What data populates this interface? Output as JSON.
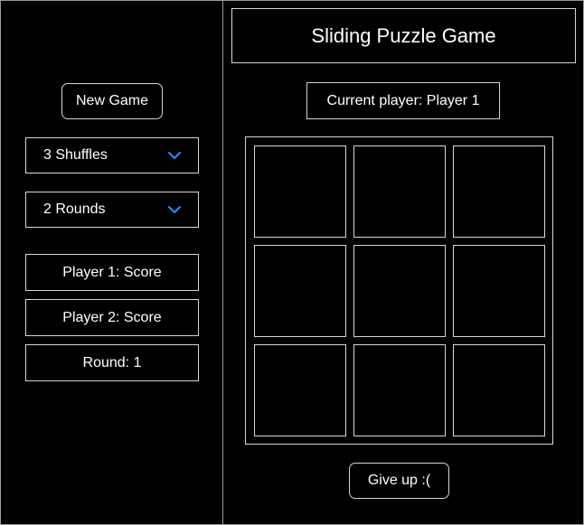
{
  "sidebar": {
    "new_game_label": "New Game",
    "shuffles": {
      "selected": "3 Shuffles",
      "icon": "chevron-down-icon",
      "icon_color": "#2f8cff"
    },
    "rounds": {
      "selected": "2 Rounds",
      "icon": "chevron-down-icon",
      "icon_color": "#2f8cff"
    },
    "player1_score": "Player 1: Score",
    "player2_score": "Player 2: Score",
    "round": "Round: 1"
  },
  "main": {
    "title": "Sliding Puzzle Game",
    "current_player": "Current player: Player 1",
    "board": {
      "rows": 3,
      "cols": 3,
      "tiles": [
        "",
        "",
        "",
        "",
        "",
        "",
        "",
        "",
        ""
      ]
    },
    "give_up_label": "Give up :("
  },
  "colors": {
    "background": "#000000",
    "border": "#d6d6d6",
    "accent": "#2f8cff",
    "text": "#ffffff"
  }
}
